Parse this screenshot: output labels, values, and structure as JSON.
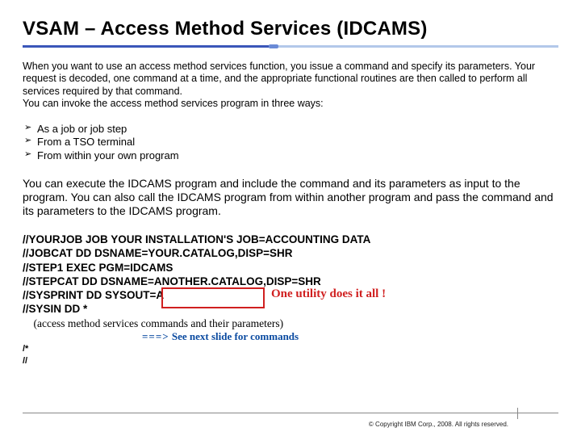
{
  "title": "VSAM – Access Method Services (IDCAMS)",
  "intro": "When you want to use an access method services function, you issue a command and specify its parameters. Your request is decoded, one command at a time, and the appropriate functional routines are then called to perform all services required by that command.\nYou can invoke the access method services program in three ways:",
  "ways": [
    "As a job or job step",
    "From a TSO terminal",
    "From within your own program"
  ],
  "exec": "You can execute the IDCAMS program and include the command and its parameters as input to the program. You can also call the IDCAMS program from within another program and pass the command and its parameters to the IDCAMS program.",
  "jcl": {
    "lines": [
      "//YOURJOB JOB YOUR INSTALLATION'S JOB=ACCOUNTING DATA",
      "//JOBCAT DD DSNAME=YOUR.CATALOG,DISP=SHR",
      "//STEP1 EXEC PGM=IDCAMS",
      "//STEPCAT DD DSNAME=ANOTHER.CATALOG,DISP=SHR",
      "//SYSPRINT DD SYSOUT=A",
      "//SYSIN DD *"
    ],
    "comment_indent": "    (access method services commands and their parameters)",
    "trailer1": "/*",
    "trailer2": "//"
  },
  "see_next": {
    "arrow": "===>",
    "text": "See next slide for commands"
  },
  "callout": "One utility does it all !",
  "copyright": "© Copyright IBM Corp., 2008. All rights reserved."
}
